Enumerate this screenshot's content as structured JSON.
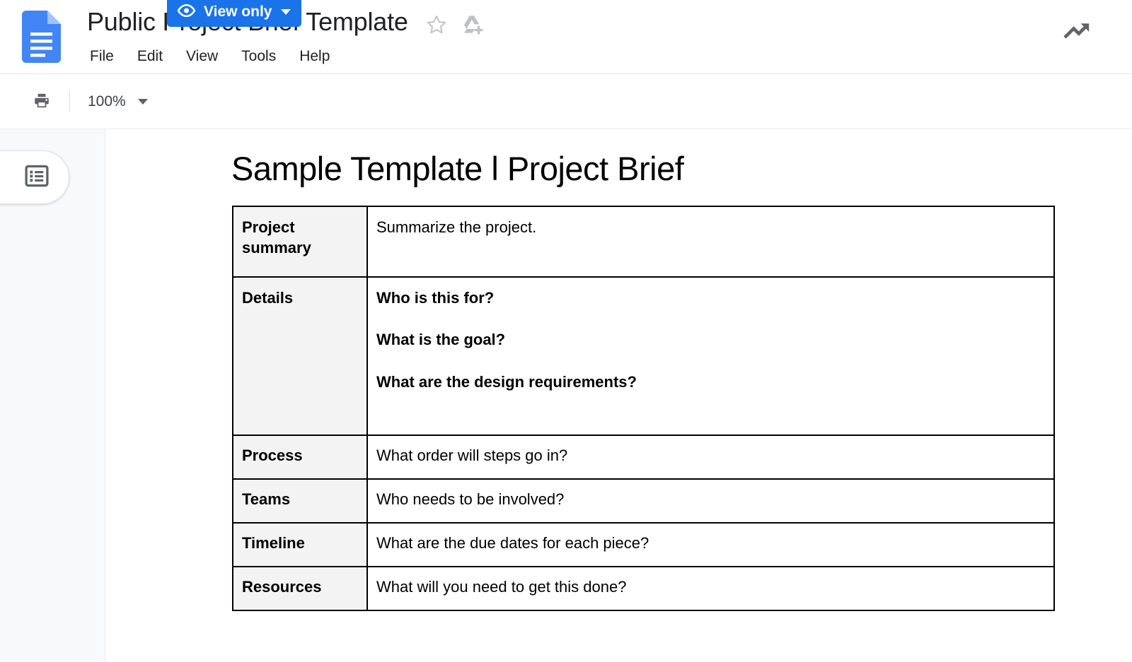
{
  "header": {
    "doc_title": "Public Project Brief Template",
    "logo_name": "google-docs-logo",
    "star_name": "star-icon",
    "drive_name": "add-to-drive-icon",
    "activity_name": "activity-dashboard-icon",
    "menu": [
      {
        "label": "File"
      },
      {
        "label": "Edit"
      },
      {
        "label": "View"
      },
      {
        "label": "Tools"
      },
      {
        "label": "Help"
      }
    ]
  },
  "toolbar": {
    "print_icon": "print-icon",
    "zoom_value": "100%",
    "view_mode_label": "View only",
    "eye_icon": "eye-icon",
    "accent_color": "#1a73e8"
  },
  "sidebar": {
    "outline_toggle_name": "document-outline-toggle",
    "outline_icon": "outline-list-icon"
  },
  "document": {
    "heading": "Sample Template l Project Brief",
    "table": {
      "rows": [
        {
          "label": "Project summary",
          "content": [
            "Summarize the project."
          ],
          "bold_content": false,
          "size": "summary"
        },
        {
          "label": "Details",
          "content": [
            "Who is this for?",
            "What is the goal?",
            "What are the design requirements?"
          ],
          "bold_content": true,
          "size": "details"
        },
        {
          "label": "Process",
          "content": [
            "What order will steps go in?"
          ],
          "bold_content": false,
          "size": "compact"
        },
        {
          "label": "Teams",
          "content": [
            "Who needs to be involved?"
          ],
          "bold_content": false,
          "size": "compact"
        },
        {
          "label": "Timeline",
          "content": [
            "What are the due dates for each piece?"
          ],
          "bold_content": false,
          "size": "compact"
        },
        {
          "label": "Resources",
          "content": [
            "What will you need to get this done?"
          ],
          "bold_content": false,
          "size": "compact"
        }
      ]
    }
  }
}
